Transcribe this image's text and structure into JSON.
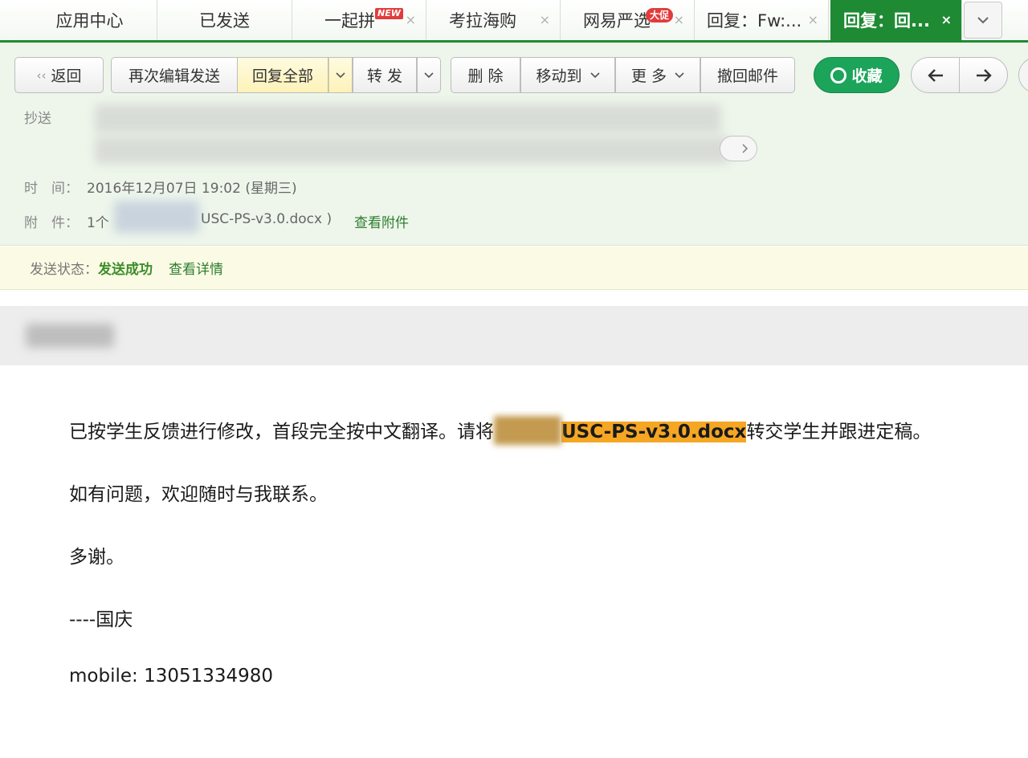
{
  "tabs": [
    {
      "label": "应用中心",
      "closable": false,
      "active": false
    },
    {
      "label": "已发送",
      "closable": false,
      "active": false
    },
    {
      "label": "一起拼",
      "badge": "NEW",
      "closable": true,
      "active": false
    },
    {
      "label": "考拉海购",
      "closable": true,
      "active": false
    },
    {
      "label": "网易严选",
      "badge": "大促",
      "closable": true,
      "active": false
    },
    {
      "label": "回复：Fw:...",
      "closable": true,
      "active": false
    },
    {
      "label": "回复：回...",
      "closable": true,
      "active": true
    }
  ],
  "tab_close_glyph": "×",
  "tab_more_icon": "chevron-down-icon",
  "toolbar": {
    "back": "返回",
    "reedit": "再次编辑发送",
    "reply_all": "回复全部",
    "forward": "转 发",
    "delete": "删 除",
    "move_to": "移动到",
    "more": "更 多",
    "recall": "撤回邮件",
    "favorite": "收藏",
    "prev_icon": "arrow-left-icon",
    "next_icon": "arrow-right-icon"
  },
  "header": {
    "cc_label": "抄送",
    "time_label": "时　间：",
    "time_value": "2016年12月07日 19:02 (星期三)",
    "attachment_label": "附　件：",
    "attachment_count": "1个",
    "attachment_name": "USC-PS-v3.0.docx )",
    "view_attachment": "查看附件"
  },
  "status": {
    "label": "发送状态：",
    "value": "发送成功",
    "details_link": "查看详情"
  },
  "body": {
    "line1_before": "已按学生反馈进行修改，首段完全按中文翻译。请将",
    "line1_file": "USC-PS-v3.0.docx",
    "line1_after": "转交学生并跟进定稿。",
    "line2": "如有问题，欢迎随时与我联系。",
    "line3": "多谢。",
    "line4": "----国庆",
    "line5": "mobile: 13051334980"
  },
  "colors": {
    "accent_green": "#1e8a33",
    "favorite_green": "#1ca45a",
    "highlight_orange": "#f5a623",
    "badge_red": "#e23b3b"
  }
}
